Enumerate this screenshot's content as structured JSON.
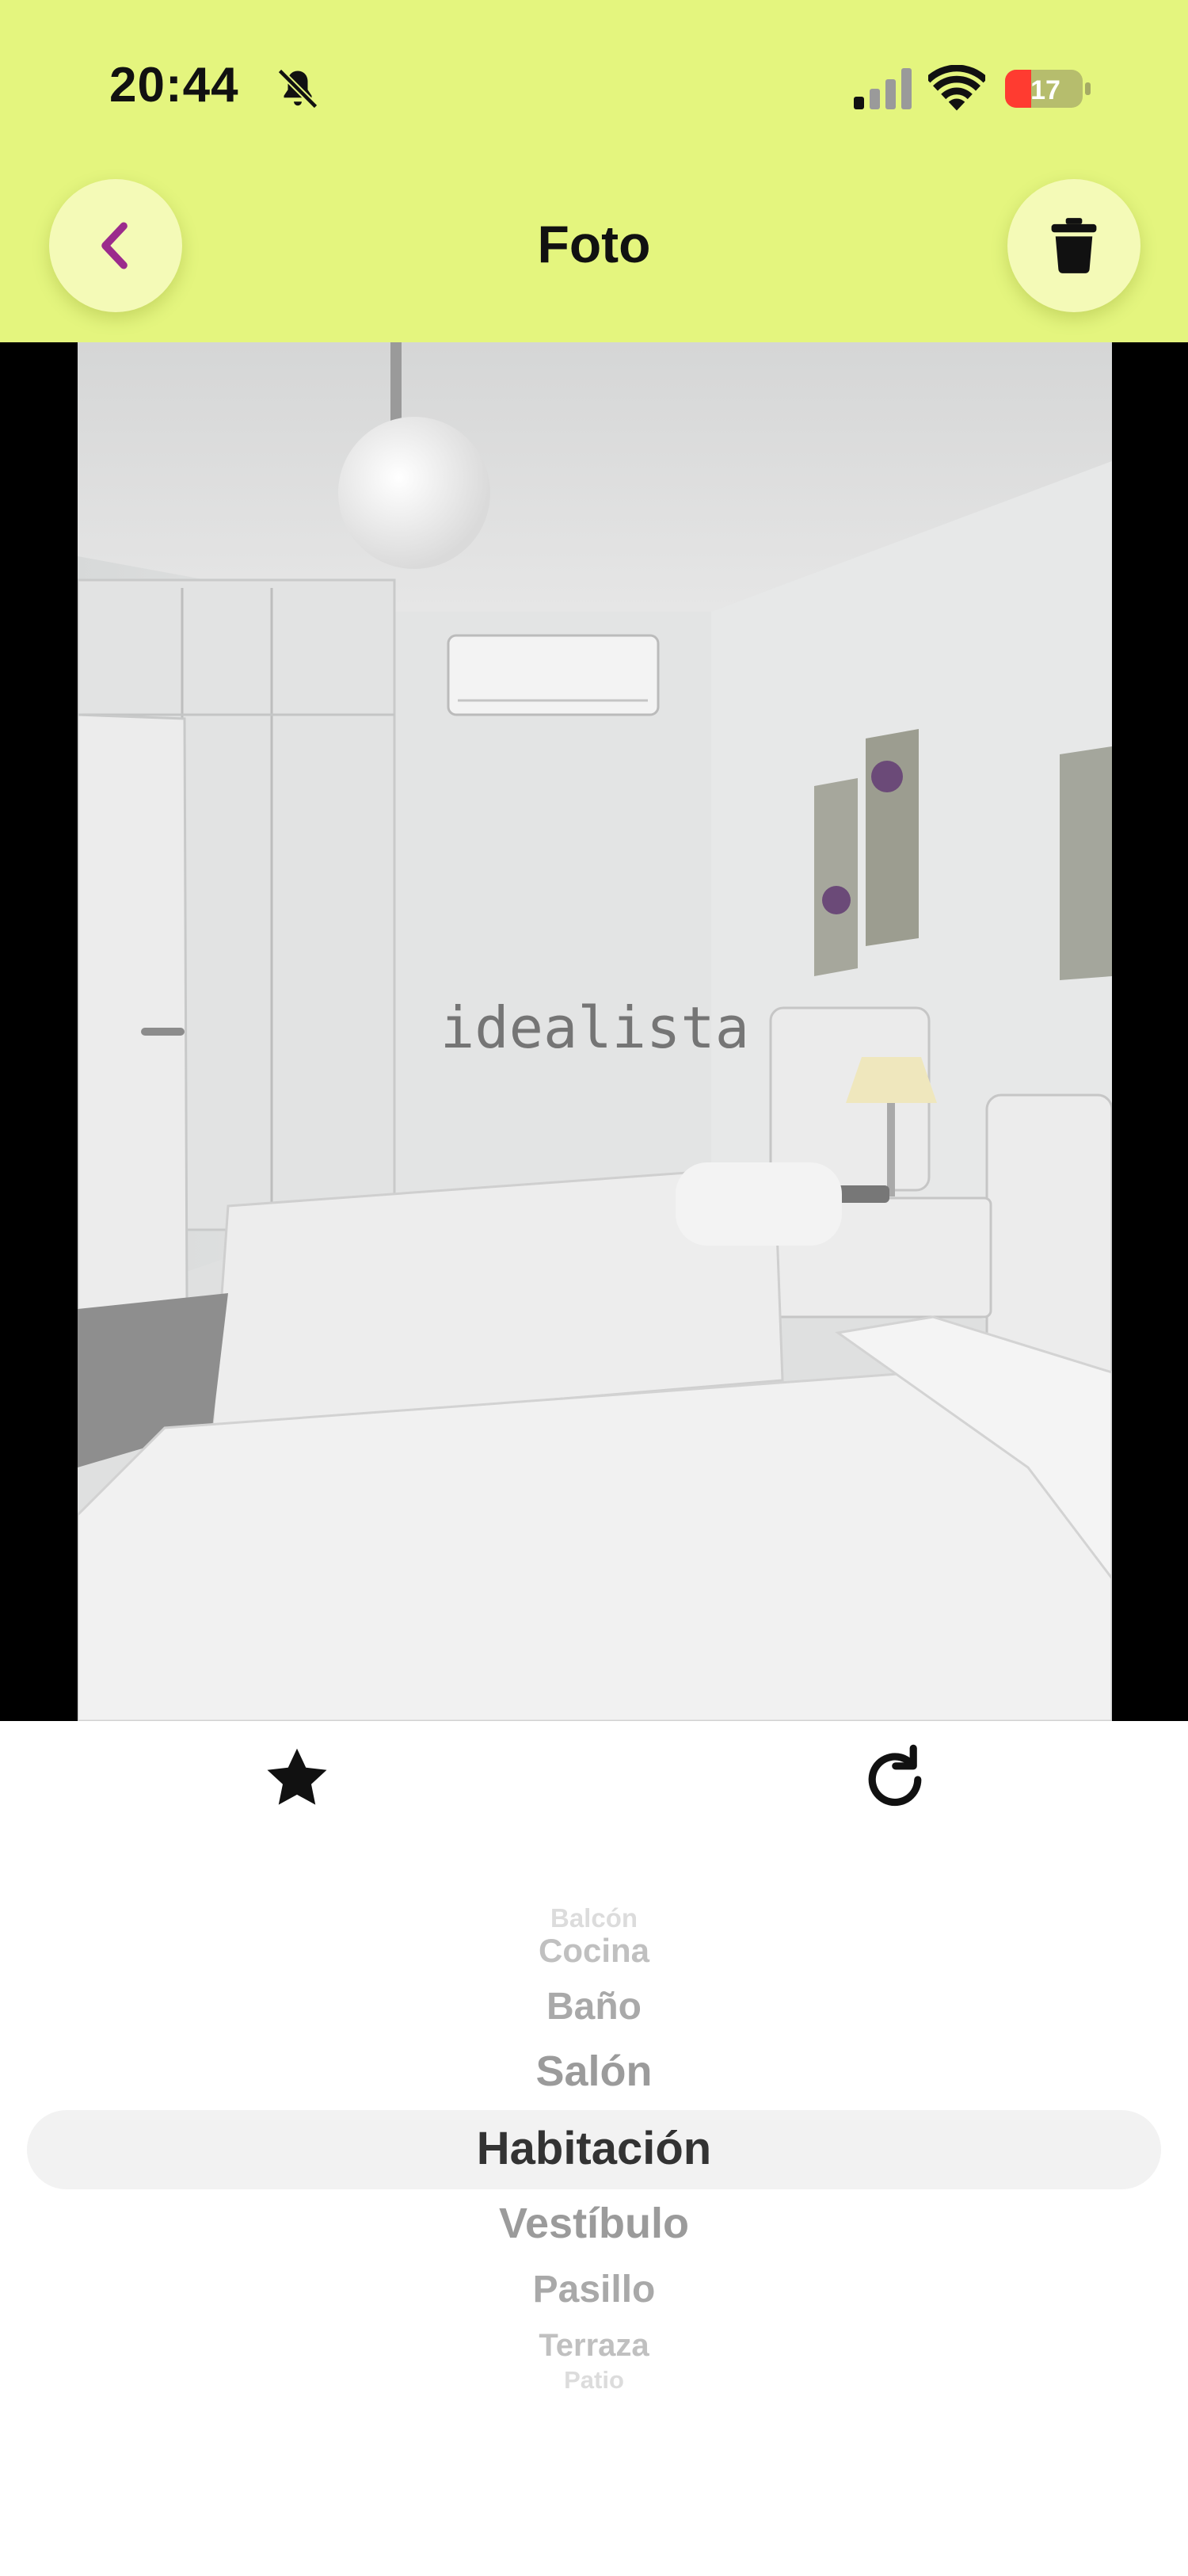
{
  "status_bar": {
    "time": "20:44",
    "battery_level": "17",
    "icons": [
      "bell-slash-icon",
      "signal-icon",
      "wifi-icon",
      "battery-icon"
    ]
  },
  "header": {
    "title": "Foto",
    "back_icon": "chevron-left-icon",
    "delete_icon": "trash-icon"
  },
  "photo": {
    "watermark": "idealista"
  },
  "actions": {
    "favorite_icon": "star-icon",
    "rotate_icon": "rotate-icon"
  },
  "room_picker": {
    "selected": "Habitación",
    "options": [
      "Balcón",
      "Cocina",
      "Baño",
      "Salón",
      "Habitación",
      "Vestíbulo",
      "Pasillo",
      "Terraza",
      "Patio"
    ]
  },
  "colors": {
    "header_bg": "#e4f57e",
    "button_bg": "#f4fab7",
    "accent_purple": "#9b2b8c"
  }
}
